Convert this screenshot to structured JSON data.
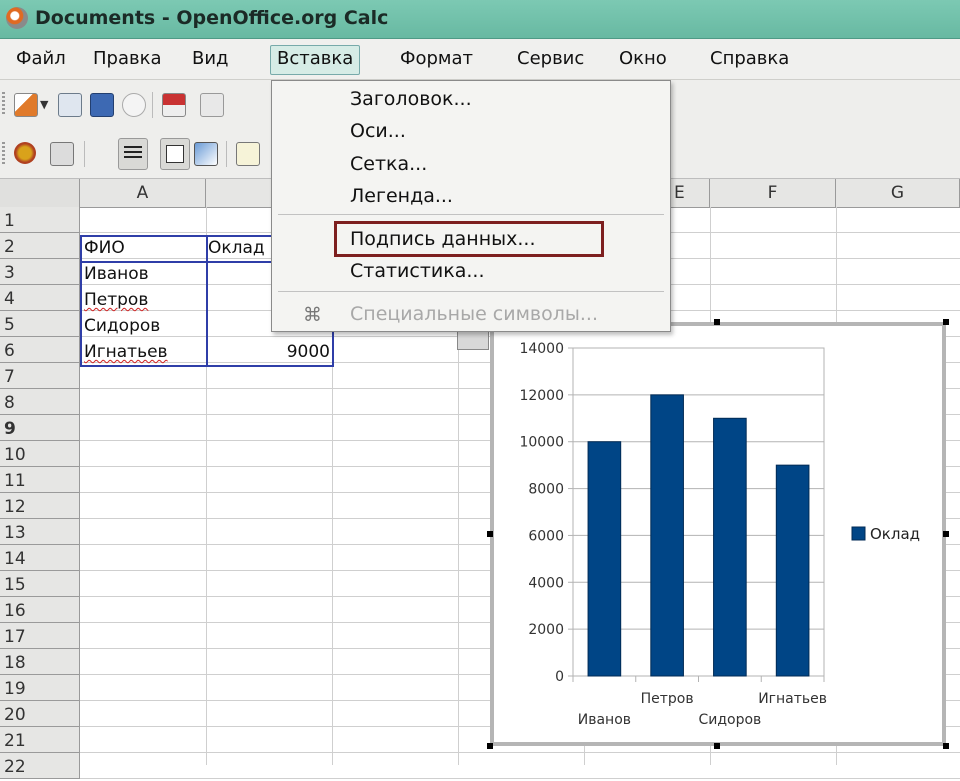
{
  "window": {
    "title": "Documents - OpenOffice.org Calc"
  },
  "menubar": [
    {
      "label": "Файл",
      "active": false
    },
    {
      "label": "Правка",
      "active": false
    },
    {
      "label": "Вид",
      "active": false
    },
    {
      "label": "Вставка",
      "active": true
    },
    {
      "label": "Формат",
      "active": false
    },
    {
      "label": "Сервис",
      "active": false
    },
    {
      "label": "Окно",
      "active": false
    },
    {
      "label": "Справка",
      "active": false
    }
  ],
  "insert_menu": {
    "items": [
      {
        "label": "Заголовок...",
        "enabled": true
      },
      {
        "label": "Оси...",
        "enabled": true
      },
      {
        "label": "Сетка...",
        "enabled": true
      },
      {
        "label": "Легенда...",
        "enabled": true
      },
      {
        "label": "Подпись данных...",
        "enabled": true,
        "highlighted": true
      },
      {
        "label": "Статистика...",
        "enabled": true
      },
      {
        "label": "Специальные символы...",
        "enabled": false,
        "icon": "command-icon"
      }
    ]
  },
  "sheet": {
    "columns": [
      "A",
      "E",
      "F",
      "G"
    ],
    "rows": [
      "1",
      "2",
      "3",
      "4",
      "5",
      "6",
      "7",
      "8",
      "9",
      "10",
      "11",
      "12",
      "13",
      "14",
      "15",
      "16",
      "17",
      "18",
      "19",
      "20",
      "21",
      "22"
    ],
    "active_row": "9",
    "cells": {
      "A2": "ФИО",
      "B2": "Оклад",
      "A3": "Иванов",
      "A4": "Петров",
      "A5": "Сидоров",
      "A6": "Игнатьев",
      "B6": "9000"
    }
  },
  "chart_data": {
    "type": "bar",
    "categories": [
      "Иванов",
      "Петров",
      "Сидоров",
      "Игнатьев"
    ],
    "series": [
      {
        "name": "Оклад",
        "values": [
          10000,
          12000,
          11000,
          9000
        ],
        "color": "#004586"
      }
    ],
    "y_ticks": [
      0,
      2000,
      4000,
      6000,
      8000,
      10000,
      12000,
      14000
    ],
    "ylim": [
      0,
      14000
    ],
    "grid": true,
    "legend": "right",
    "category_label_text": "Игнатьев"
  }
}
